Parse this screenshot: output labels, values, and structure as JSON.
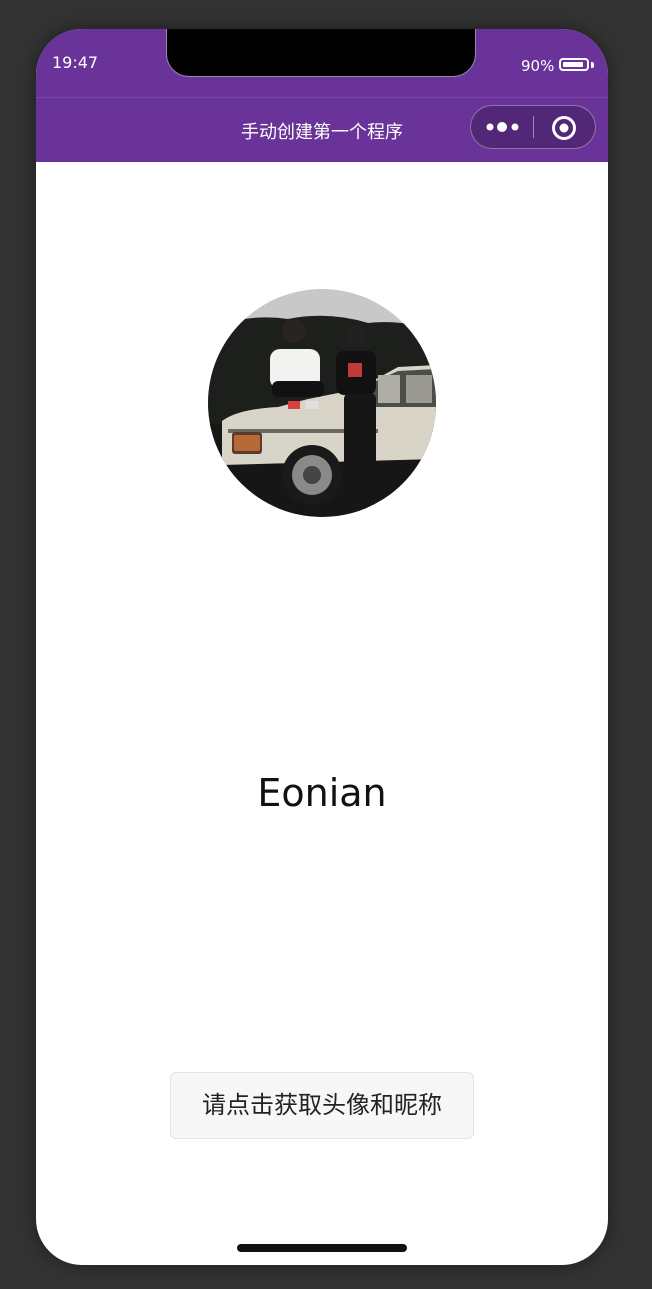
{
  "status_bar": {
    "time": "19:47",
    "battery_percent": "90%",
    "battery_level": 0.9
  },
  "nav_bar": {
    "title": "手动创建第一个程序",
    "background_color": "#6a3399"
  },
  "capsule": {
    "more_icon": "more-dots-icon",
    "close_icon": "target-circle-icon"
  },
  "profile": {
    "avatar": "avatar-photo",
    "nickname": "Eonian"
  },
  "action": {
    "get_profile_label": "请点击获取头像和昵称"
  }
}
